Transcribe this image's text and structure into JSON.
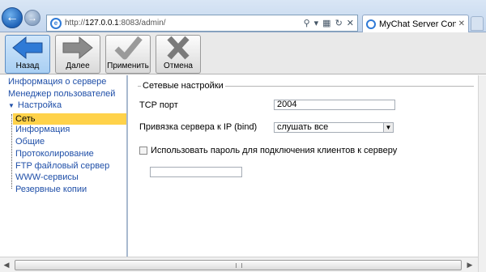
{
  "browser": {
    "url_prefix": "http://",
    "url_host": "127.0.0.1",
    "url_rest": ":8083/admin/",
    "tab_title": "MyChat Server Console",
    "icons": {
      "back": "back-arrow-icon",
      "forward": "forward-arrow-icon",
      "page": "ie-page-icon",
      "search": "search-icon",
      "refresh": "refresh-icon",
      "stop": "stop-icon",
      "close": "close-icon"
    }
  },
  "toolbar": {
    "back_label": "Назад",
    "forward_label": "Далее",
    "apply_label": "Применить",
    "cancel_label": "Отмена",
    "colors": {
      "back_arrow": "#2f7ad6",
      "forward_arrow": "#8a8a8a",
      "apply_check": "#9a9a9a",
      "cancel_x": "#7a7a7a"
    }
  },
  "sidebar": {
    "server_info": "Информация о сервере",
    "user_manager": "Менеджер пользователей",
    "settings_section": "Настройка",
    "items": [
      {
        "label": "Сеть"
      },
      {
        "label": "Информация"
      },
      {
        "label": "Общие"
      },
      {
        "label": "Протоколирование"
      },
      {
        "label": "FTP файловый сервер"
      },
      {
        "label": "WWW-сервисы"
      },
      {
        "label": "Резервные копии"
      }
    ],
    "selected_color": "#ffd24a",
    "link_color": "#1f4fa8"
  },
  "main": {
    "group_title": "Сетевые настройки",
    "tcp_port_label": "TCP порт",
    "tcp_port_value": "2004",
    "bind_label": "Привязка сервера к IP (bind)",
    "bind_value": "слушать все",
    "password_checkbox_label": "Использовать пароль для подключения клиентов к серверу",
    "password_checked": false,
    "password_value": ""
  }
}
